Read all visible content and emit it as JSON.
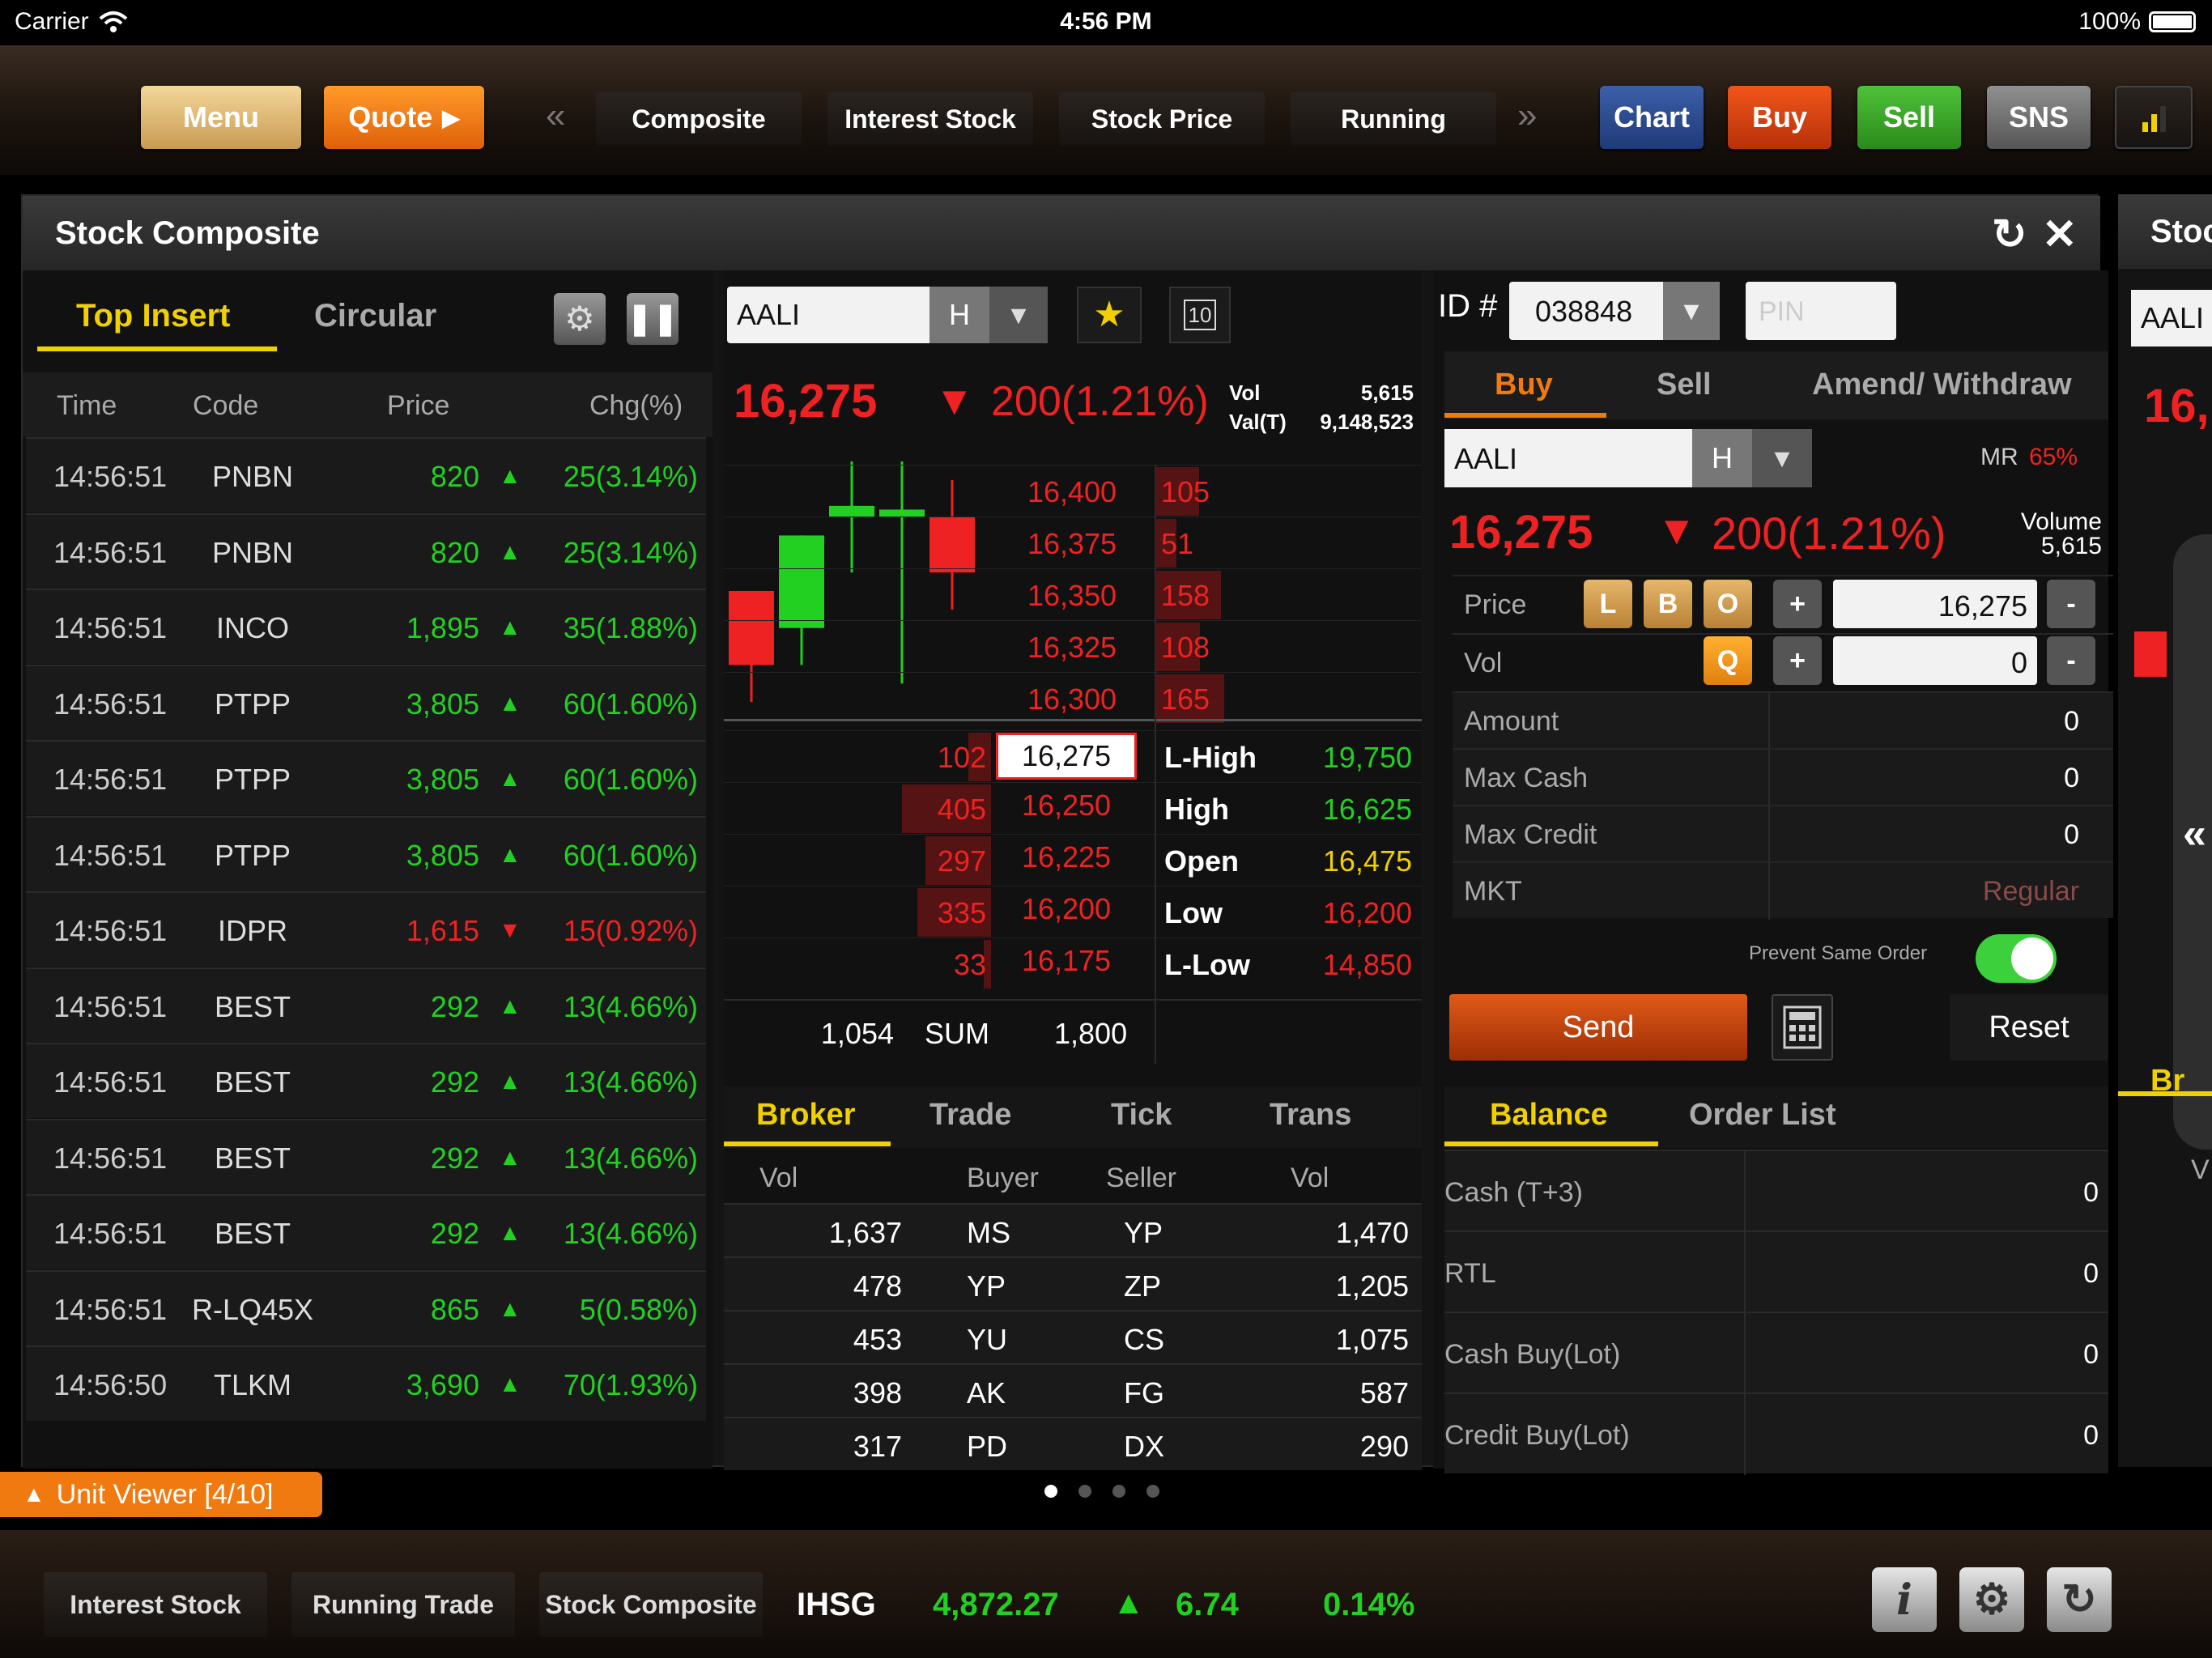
{
  "status": {
    "carrier": "Carrier",
    "time": "4:56 PM",
    "battery": "100%"
  },
  "toolbar": {
    "menu": "Menu",
    "quote": "Quote",
    "tabs": [
      "Composite",
      "Interest Stock",
      "Stock Price",
      "Running"
    ],
    "chart": "Chart",
    "buy": "Buy",
    "sell": "Sell",
    "sns": "SNS"
  },
  "panel": {
    "title": "Stock Composite",
    "peek_title": "Stoc"
  },
  "left": {
    "tabs": [
      "Top Insert",
      "Circular"
    ],
    "columns": [
      "Time",
      "Code",
      "Price",
      "Chg(%)"
    ],
    "rows": [
      {
        "time": "14:56:51",
        "code": "PNBN",
        "price": "820",
        "chg": "25(3.14%)",
        "dir": "up"
      },
      {
        "time": "14:56:51",
        "code": "PNBN",
        "price": "820",
        "chg": "25(3.14%)",
        "dir": "up"
      },
      {
        "time": "14:56:51",
        "code": "INCO",
        "price": "1,895",
        "chg": "35(1.88%)",
        "dir": "up"
      },
      {
        "time": "14:56:51",
        "code": "PTPP",
        "price": "3,805",
        "chg": "60(1.60%)",
        "dir": "up"
      },
      {
        "time": "14:56:51",
        "code": "PTPP",
        "price": "3,805",
        "chg": "60(1.60%)",
        "dir": "up"
      },
      {
        "time": "14:56:51",
        "code": "PTPP",
        "price": "3,805",
        "chg": "60(1.60%)",
        "dir": "up"
      },
      {
        "time": "14:56:51",
        "code": "IDPR",
        "price": "1,615",
        "chg": "15(0.92%)",
        "dir": "down"
      },
      {
        "time": "14:56:51",
        "code": "BEST",
        "price": "292",
        "chg": "13(4.66%)",
        "dir": "up"
      },
      {
        "time": "14:56:51",
        "code": "BEST",
        "price": "292",
        "chg": "13(4.66%)",
        "dir": "up"
      },
      {
        "time": "14:56:51",
        "code": "BEST",
        "price": "292",
        "chg": "13(4.66%)",
        "dir": "up"
      },
      {
        "time": "14:56:51",
        "code": "BEST",
        "price": "292",
        "chg": "13(4.66%)",
        "dir": "up"
      },
      {
        "time": "14:56:51",
        "code": "R-LQ45X",
        "price": "865",
        "chg": "5(0.58%)",
        "dir": "up"
      },
      {
        "time": "14:56:50",
        "code": "TLKM",
        "price": "3,690",
        "chg": "70(1.93%)",
        "dir": "up"
      }
    ]
  },
  "mid": {
    "symbol": "AALI",
    "board": "H",
    "last": "16,275",
    "change": "200(1.21%)",
    "vol_label": "Vol",
    "vol": "5,615",
    "valt_label": "Val(T)",
    "valt": "9,148,523",
    "offers": [
      {
        "price": "16,400",
        "qty": "105"
      },
      {
        "price": "16,375",
        "qty": "51"
      },
      {
        "price": "16,350",
        "qty": "158"
      },
      {
        "price": "16,325",
        "qty": "108"
      },
      {
        "price": "16,300",
        "qty": "165"
      }
    ],
    "bids": [
      {
        "qty": "102",
        "price": "16,275",
        "label": "L-High",
        "val": "19,750",
        "vcolor": "g"
      },
      {
        "qty": "405",
        "price": "16,250",
        "label": "High",
        "val": "16,625",
        "vcolor": "g"
      },
      {
        "qty": "297",
        "price": "16,225",
        "label": "Open",
        "val": "16,475",
        "vcolor": "y"
      },
      {
        "qty": "335",
        "price": "16,200",
        "label": "Low",
        "val": "16,200",
        "vcolor": "r"
      },
      {
        "qty": "33",
        "price": "16,175",
        "label": "L-Low",
        "val": "14,850",
        "vcolor": "r"
      }
    ],
    "sum_bid": "1,054",
    "sum_label": "SUM",
    "sum_offer": "1,800",
    "tabs": [
      "Broker",
      "Trade",
      "Tick",
      "Trans"
    ],
    "broker_cols": [
      "Vol",
      "Buyer",
      "Seller",
      "Vol"
    ],
    "broker_rows": [
      {
        "bv": "1,637",
        "buyer": "MS",
        "seller": "YP",
        "sv": "1,470"
      },
      {
        "bv": "478",
        "buyer": "YP",
        "seller": "ZP",
        "sv": "1,205"
      },
      {
        "bv": "453",
        "buyer": "YU",
        "seller": "CS",
        "sv": "1,075"
      },
      {
        "bv": "398",
        "buyer": "AK",
        "seller": "FG",
        "sv": "587"
      },
      {
        "bv": "317",
        "buyer": "PD",
        "seller": "DX",
        "sv": "290"
      }
    ],
    "candles": [
      {
        "open": 16175,
        "close": 16275,
        "high": 16275,
        "low": 16125,
        "dir": "down"
      },
      {
        "open": 16225,
        "close": 16350,
        "high": 16350,
        "low": 16175,
        "dir": "up"
      },
      {
        "open": 16375,
        "close": 16390,
        "high": 16450,
        "low": 16300,
        "dir": "up"
      },
      {
        "open": 16375,
        "close": 16385,
        "high": 16450,
        "low": 16150,
        "dir": "up"
      },
      {
        "open": 16375,
        "close": 16300,
        "high": 16425,
        "low": 16250,
        "dir": "down"
      }
    ]
  },
  "order": {
    "id_label": "ID #",
    "id": "038848",
    "pin_placeholder": "PIN",
    "tabs": [
      "Buy",
      "Sell",
      "Amend/ Withdraw"
    ],
    "symbol": "AALI",
    "board": "H",
    "mr_label": "MR",
    "mr": "65%",
    "last": "16,275",
    "change": "200(1.21%)",
    "volume_label": "Volume",
    "volume": "5,615",
    "price_label": "Price",
    "price_btns": [
      "L",
      "B",
      "O"
    ],
    "price": "16,275",
    "vol_label": "Vol",
    "vol_btn": "Q",
    "vol": "0",
    "fields": [
      {
        "label": "Amount",
        "value": "0"
      },
      {
        "label": "Max Cash",
        "value": "0"
      },
      {
        "label": "Max Credit",
        "value": "0"
      },
      {
        "label": "MKT",
        "value": "Regular"
      }
    ],
    "prevent_label": "Prevent Same Order",
    "send": "Send",
    "reset": "Reset",
    "bal_tabs": [
      "Balance",
      "Order List"
    ],
    "balances": [
      {
        "label": "Cash (T+3)",
        "value": "0"
      },
      {
        "label": "RTL",
        "value": "0"
      },
      {
        "label": "Cash Buy(Lot)",
        "value": "0"
      },
      {
        "label": "Credit Buy(Lot)",
        "value": "0"
      }
    ]
  },
  "peek": {
    "symbol": "AALI",
    "price": "16,",
    "tab": "Br",
    "col": "V"
  },
  "unit_viewer": "Unit Viewer [4/10]",
  "bottom": {
    "tabs": [
      "Interest Stock",
      "Running Trade",
      "Stock Composite"
    ],
    "index": "IHSG",
    "index_value": "4,872.27",
    "index_change": "6.74",
    "index_pct": "0.14%"
  },
  "colors": {
    "up": "#22d022",
    "down": "#ee2222",
    "accent": "#f07a10",
    "highlight": "#f0d000"
  }
}
